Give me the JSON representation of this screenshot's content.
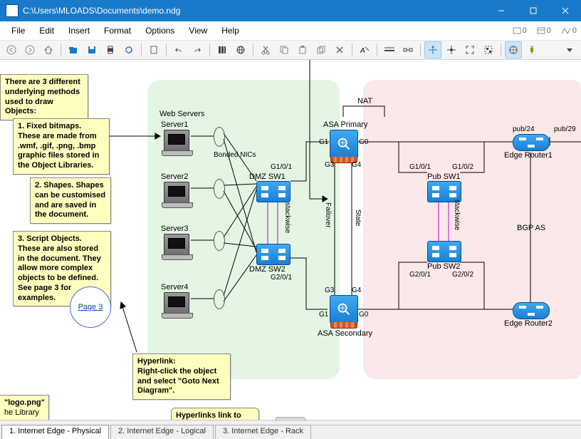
{
  "window": {
    "title": "C:\\Users\\MLOADS\\Documents\\demo.ndg"
  },
  "menu": {
    "file": "File",
    "edit": "Edit",
    "insert": "Insert",
    "format": "Format",
    "options": "Options",
    "view": "View",
    "help": "Help"
  },
  "indicators": {
    "box": "0",
    "page": "0",
    "zig": "0"
  },
  "zones": {
    "web_title": "Web Servers"
  },
  "servers": {
    "s1": "Server1",
    "s2": "Server2",
    "s3": "Server3",
    "s4": "Server4",
    "bonded": "Bonded NICs"
  },
  "switches": {
    "dmz1": "DMZ SW1",
    "dmz2": "DMZ SW2",
    "pub1": "Pub SW1",
    "pub2": "Pub SW2",
    "g101": "G1/0/1",
    "g201": "G2/0/1",
    "pg101": "G1/0/1",
    "pg102": "G1/0/2",
    "pg201": "G2/0/1",
    "pg202": "G2/0/2",
    "stackwise": "stackwise",
    "stackwise2": "stackwise"
  },
  "asa": {
    "primary": "ASA Primary",
    "secondary": "ASA Secondary",
    "g0": "G0",
    "g1": "G1",
    "g3": "G3",
    "g4": "G4",
    "nat": "NAT",
    "failover": "Failover",
    "state": "State"
  },
  "routers": {
    "r1": "Edge Router1",
    "r2": "Edge Router2",
    "pub24": "pub/24",
    "pub29": "pub/29",
    "bgp": "BGP AS"
  },
  "notes": {
    "n1": "There are 3 different underlying methods used to draw Objects:",
    "n2": "1. Fixed bitmaps. These are made from .wmf, .gif, .png, .bmp graphic files stored in the Object Libraries.",
    "n3": "2. Shapes. Shapes can be customised and are saved in the document.",
    "n4": "3. Script Objects. These are also stored in the document. They allow more complex objects to be defined. See page 3 for examples.",
    "hyp": "Hyperlink:\nRight-click the object and select \"Goto Next Diagram\".",
    "hyp2": "Hyperlinks link to",
    "logo": "\"logo.png\"",
    "logotail": "he Library"
  },
  "pagelink": {
    "label": "Page 3"
  },
  "tabs": {
    "t1": "1. Internet Edge - Physical",
    "t2": "2. Internet Edge - Logical",
    "t3": "3. Internet Edge - Rack"
  }
}
